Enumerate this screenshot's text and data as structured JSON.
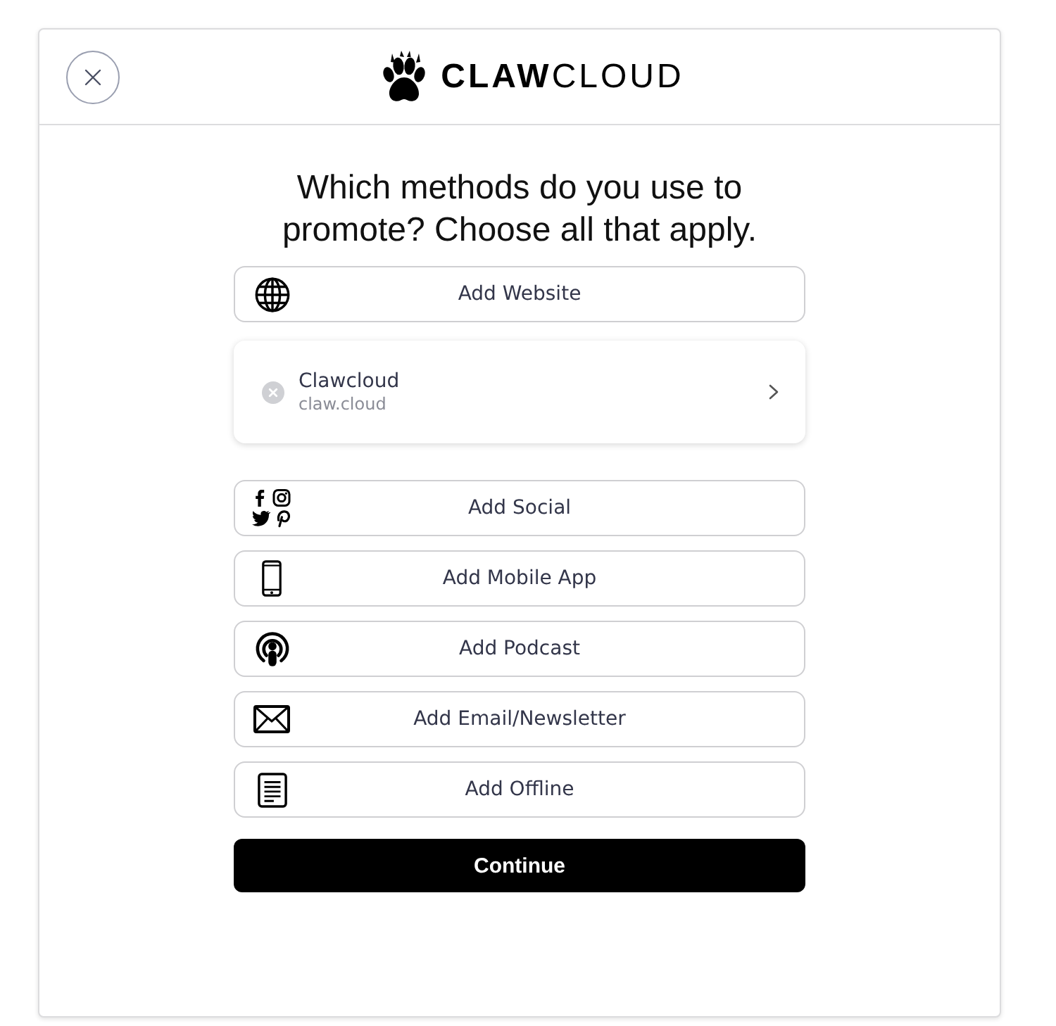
{
  "header": {
    "logo_text": "**CLAW**CLOUD"
  },
  "heading": "Which methods do you use to promote? Choose all that apply.",
  "methods": [
    {
      "kind": "website",
      "label": "Add Website",
      "entries": [
        {
          "name": "Clawcloud",
          "url": "claw.cloud"
        }
      ]
    },
    {
      "kind": "social",
      "label": "Add Social"
    },
    {
      "kind": "mobile_app",
      "label": "Add Mobile App"
    },
    {
      "kind": "podcast",
      "label": "Add Podcast"
    },
    {
      "kind": "email",
      "label": "Add Email/Newsletter"
    },
    {
      "kind": "offline",
      "label": "Add Offline"
    }
  ],
  "continue_button": "Continue"
}
